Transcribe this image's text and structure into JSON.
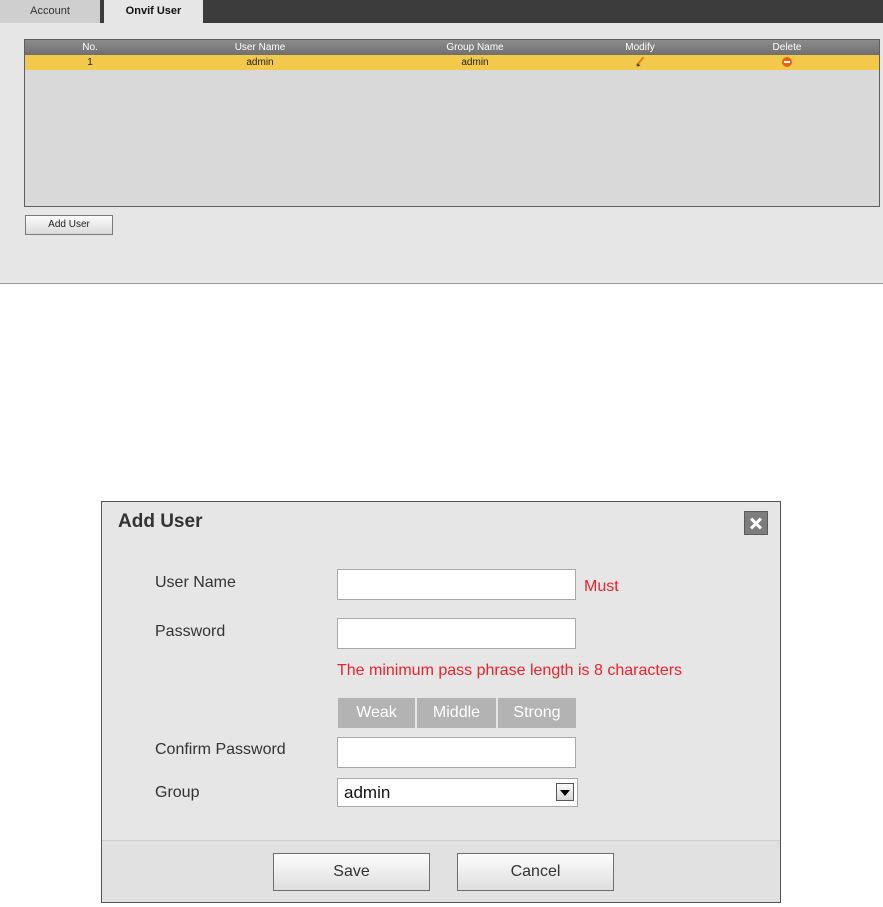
{
  "tabs": [
    "Account",
    "Onvif User"
  ],
  "active_tab": "Onvif User",
  "table": {
    "headers": {
      "no": "No.",
      "user_name": "User Name",
      "group_name": "Group Name",
      "modify": "Modify",
      "delete": "Delete"
    },
    "rows": [
      {
        "no": "1",
        "user_name": "admin",
        "group_name": "admin",
        "modify_icon": "pencil-icon",
        "delete_icon": "delete-icon"
      }
    ],
    "highlight_color": "#f2c94a"
  },
  "add_user_button": "Add User",
  "dialog": {
    "title": "Add User",
    "close_icon": "close-icon",
    "fields": {
      "user_name_label": "User Name",
      "user_name_value": "",
      "must": "Must",
      "password_label": "Password",
      "password_value": "",
      "password_hint": "The minimum pass phrase length is 8 characters",
      "strength": {
        "weak": "Weak",
        "middle": "Middle",
        "strong": "Strong"
      },
      "confirm_label": "Confirm Password",
      "confirm_value": "",
      "group_label": "Group",
      "group_value": "admin"
    },
    "buttons": {
      "save": "Save",
      "cancel": "Cancel"
    }
  },
  "colors": {
    "warning_text": "#e8232a",
    "tab_bar": "#3c3c3c"
  }
}
